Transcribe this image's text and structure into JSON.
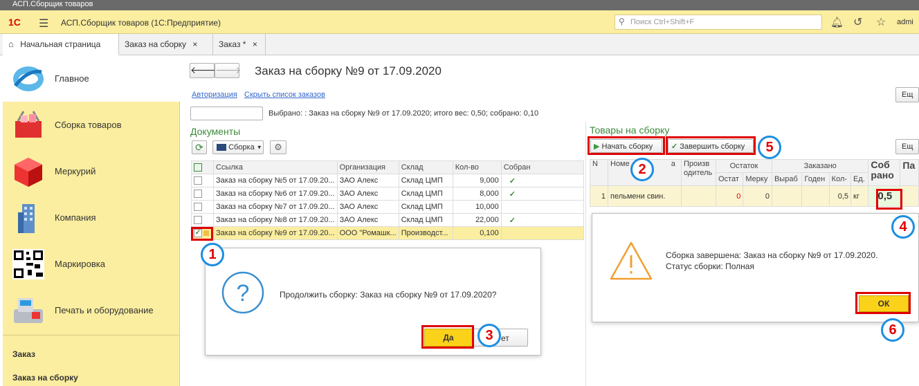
{
  "window": {
    "title": "АСП.Сборщик товаров"
  },
  "app": {
    "title": "АСП.Сборщик товаров  (1С:Предприятие)",
    "logo": "1С",
    "search_placeholder": "Поиск Ctrl+Shift+F",
    "user": "admi"
  },
  "tabs": [
    {
      "label": "Начальная страница"
    },
    {
      "label": "Заказ на сборку"
    },
    {
      "label": "Заказ *"
    }
  ],
  "sidebar": {
    "items": [
      {
        "label": "Главное"
      },
      {
        "label": "Сборка товаров"
      },
      {
        "label": "Меркурий"
      },
      {
        "label": "Компания"
      },
      {
        "label": "Маркировка"
      },
      {
        "label": "Печать и оборудование"
      }
    ],
    "bottom": [
      {
        "label": "Заказ"
      },
      {
        "label": "Заказ на сборку"
      }
    ]
  },
  "main": {
    "title": "Заказ на сборку №9 от 17.09.2020",
    "link_auth": "Авторизация",
    "link_hide": "Скрыть список заказов",
    "selected_text": "Выбрано: : Заказ на сборку №9 от 17.09.2020; итого вес: 0,50; собрано: 0,10",
    "more1": "Ещ",
    "more2": "Ещ"
  },
  "docs": {
    "title": "Документы",
    "assembly_btn": "Сборка",
    "columns": [
      "Ссылка",
      "Организация",
      "Склад",
      "Кол-во",
      "Собран"
    ],
    "rows": [
      {
        "link": "Заказ на сборку №5 от 17.09.20...",
        "org": "ЗАО Алекс",
        "warehouse": "Склад ЦМП",
        "qty": "9,000",
        "done": true
      },
      {
        "link": "Заказ на сборку №6 от 17.09.20...",
        "org": "ЗАО Алекс",
        "warehouse": "Склад ЦМП",
        "qty": "8,000",
        "done": true
      },
      {
        "link": "Заказ на сборку №7 от 17.09.20...",
        "org": "ЗАО Алекс",
        "warehouse": "Склад ЦМП",
        "qty": "10,000",
        "done": false
      },
      {
        "link": "Заказ на сборку №8 от 17.09.20...",
        "org": "ЗАО Алекс",
        "warehouse": "Склад ЦМП",
        "qty": "22,000",
        "done": true
      },
      {
        "link": "Заказ на сборку №9 от 17.09.20...",
        "org": "ООО \"Ромашк...",
        "warehouse": "Производст...",
        "qty": "0,100",
        "done": false
      }
    ]
  },
  "goods": {
    "title": "Товары на сборку",
    "start_btn": "Начать сборку",
    "finish_btn": "Завершить сборку",
    "h_n": "N",
    "h_name": "Номе",
    "h_name2": "а",
    "h_prod": "Произв одитель",
    "h_rest": "Остаток",
    "h_order": "Заказано",
    "h_collected": "Соб рано",
    "h_pa": "Па",
    "sub": {
      "rest": "Остат",
      "merk": "Мерку",
      "vyrab": "Выраб",
      "goden": "Годен",
      "qty": "Кол-",
      "unit": "Ед."
    },
    "row": {
      "n": "1",
      "name": "пельмени свин.",
      "rest": "0",
      "merk": "0",
      "qty": "0,5",
      "unit": "кг",
      "collected": "0,5"
    }
  },
  "dialog_left": {
    "text": "Продолжить сборку: Заказ на сборку №9 от 17.09.2020?",
    "yes": "Да",
    "no": "ет"
  },
  "dialog_right": {
    "line1": "Сборка завершена: Заказ на сборку №9 от 17.09.2020.",
    "line2": "Статус сборки: Полная",
    "ok": "ОК"
  },
  "markers": [
    "1",
    "2",
    "3",
    "4",
    "5",
    "6"
  ],
  "colors": {
    "accent_yellow": "#fbeea0",
    "highlight_red": "#e00000",
    "marker_blue": "#1c8ee0",
    "check_green": "#3b8a3b"
  }
}
